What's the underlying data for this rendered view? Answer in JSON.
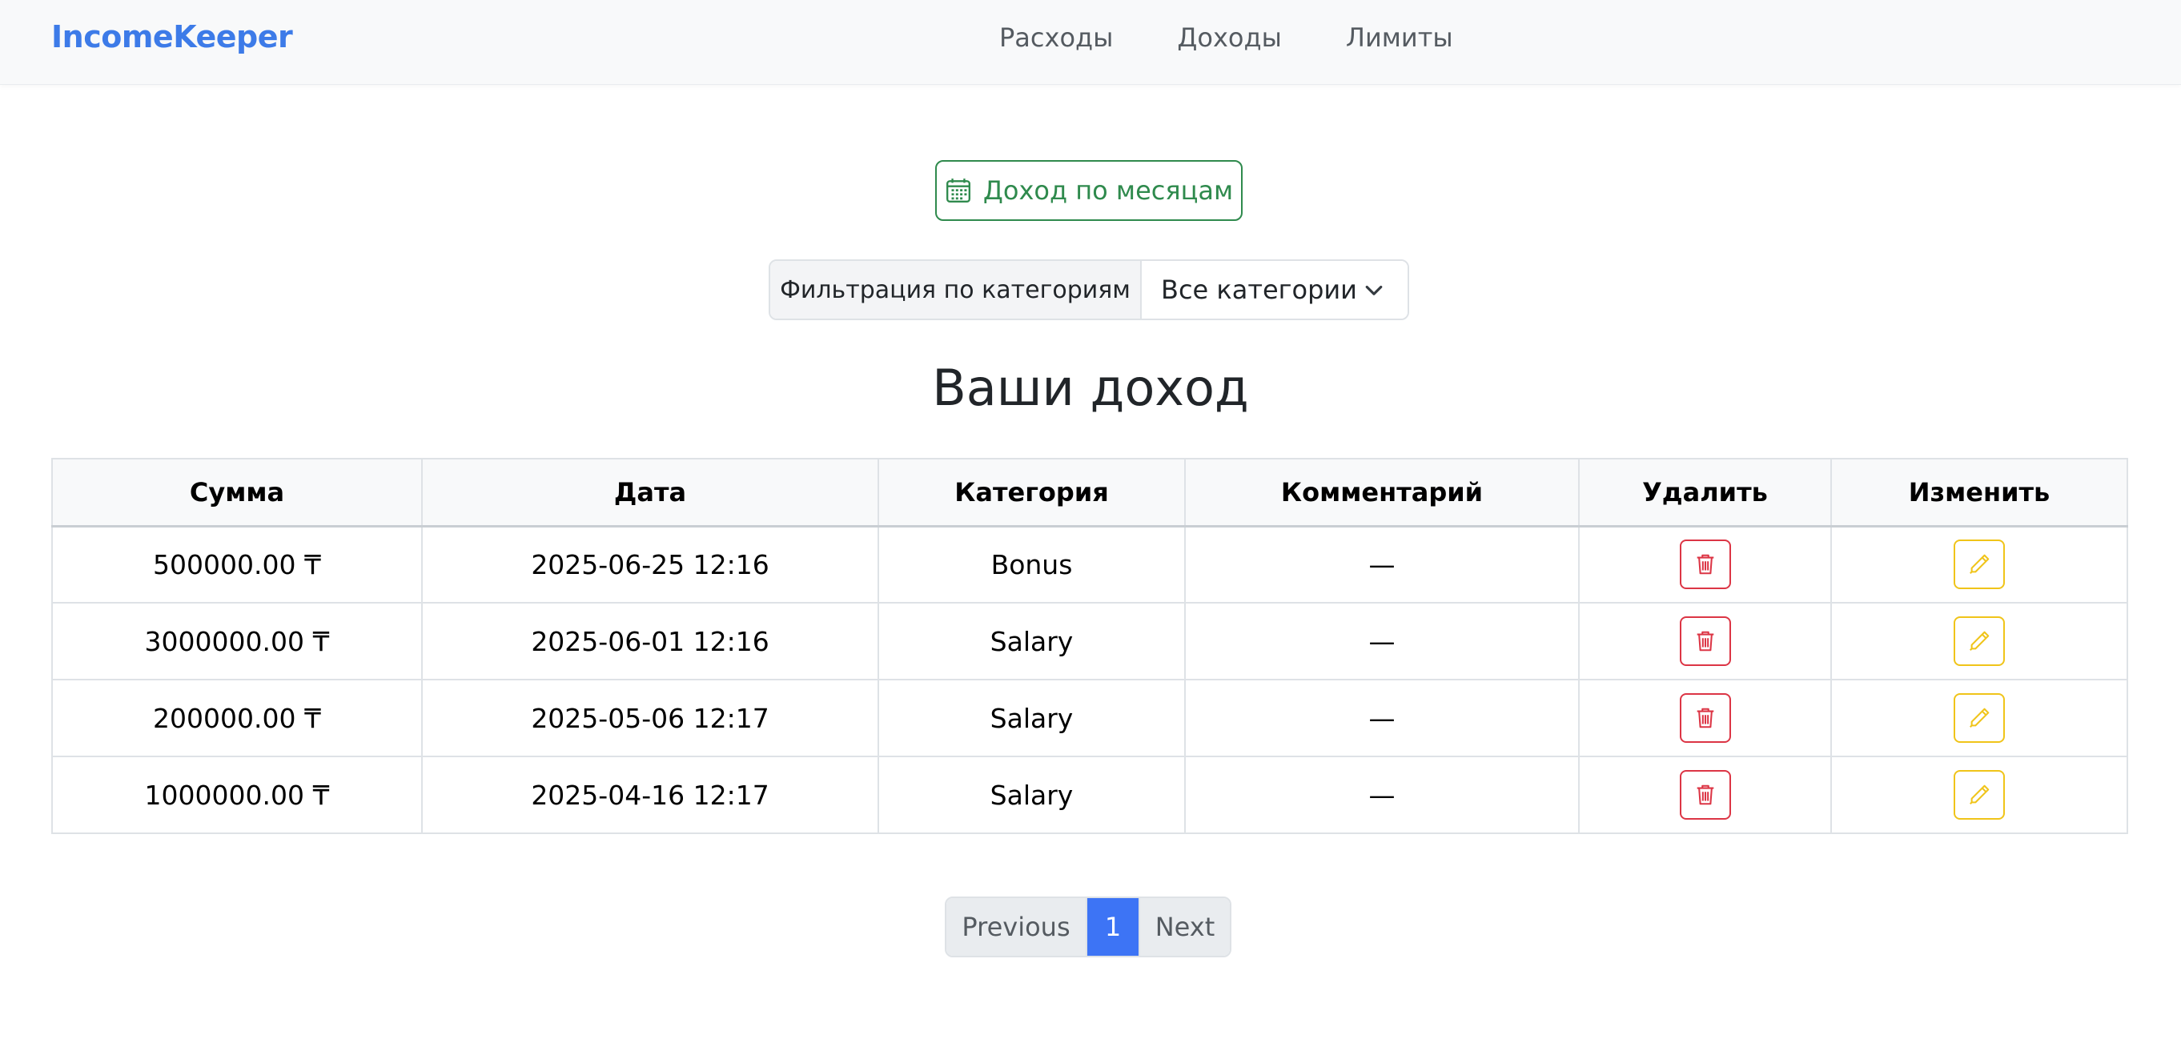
{
  "navbar": {
    "brand": "IncomeKeeper",
    "links": [
      "Расходы",
      "Доходы",
      "Лимиты"
    ]
  },
  "month_button": {
    "label": "Доход по месяцам",
    "icon": "calendar-icon"
  },
  "filter": {
    "label": "Фильтрация по категориям",
    "selected": "Все категории"
  },
  "title": "Ваши доход",
  "table": {
    "headers": [
      "Сумма",
      "Дата",
      "Категория",
      "Комментарий",
      "Удалить",
      "Изменить"
    ],
    "rows": [
      {
        "amount": "500000.00 ₸",
        "date": "2025-06-25 12:16",
        "category": "Bonus",
        "comment": "—"
      },
      {
        "amount": "3000000.00 ₸",
        "date": "2025-06-01 12:16",
        "category": "Salary",
        "comment": "—"
      },
      {
        "amount": "200000.00 ₸",
        "date": "2025-05-06 12:17",
        "category": "Salary",
        "comment": "—"
      },
      {
        "amount": "1000000.00 ₸",
        "date": "2025-04-16 12:17",
        "category": "Salary",
        "comment": "—"
      }
    ]
  },
  "pagination": {
    "previous": "Previous",
    "current": "1",
    "next": "Next"
  },
  "colors": {
    "brand": "#3d7be8",
    "success": "#2f8a4d",
    "danger": "#dc3545",
    "warning": "#f0c419",
    "primary": "#3d74f5"
  }
}
